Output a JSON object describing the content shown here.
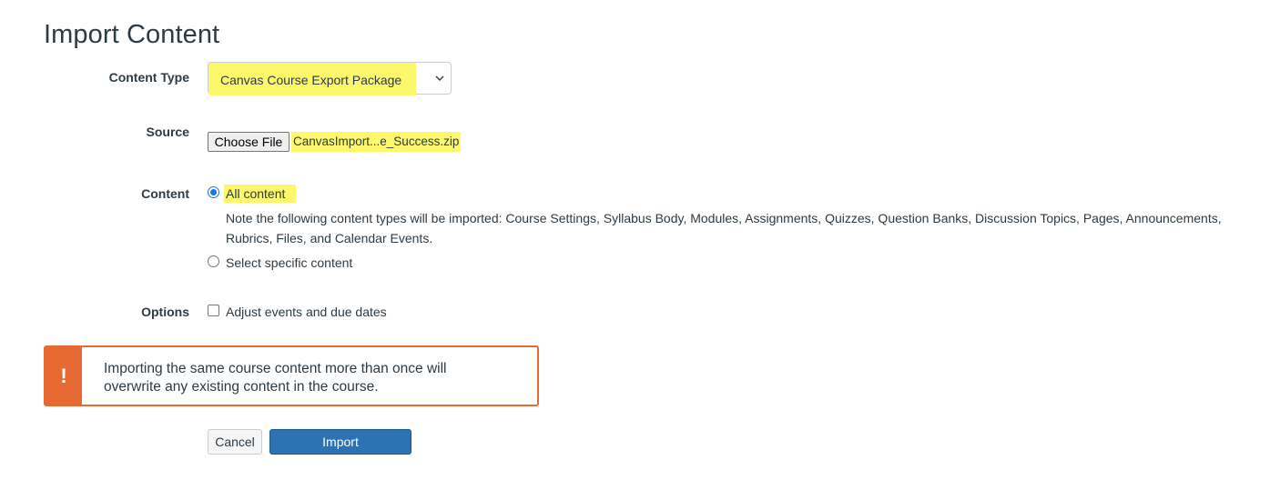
{
  "page": {
    "title": "Import Content"
  },
  "content_type": {
    "label": "Content Type",
    "selected": "Canvas Course Export Package"
  },
  "source": {
    "label": "Source",
    "choose_file_label": "Choose File",
    "file_name": "CanvasImport...e_Success.zip"
  },
  "content": {
    "label": "Content",
    "options": [
      {
        "label": "All content",
        "checked": true
      },
      {
        "label": "Select specific content",
        "checked": false
      }
    ],
    "note": "Note the following content types will be imported: Course Settings, Syllabus Body, Modules, Assignments, Quizzes, Question Banks, Discussion Topics, Pages, Announcements, Rubrics, Files, and Calendar Events."
  },
  "options": {
    "label": "Options",
    "adjust_dates_label": "Adjust events and due dates",
    "adjust_dates_checked": false
  },
  "alert": {
    "icon": "exclamation-icon",
    "text": "Importing the same course content more than once will overwrite any existing content in the course."
  },
  "actions": {
    "cancel_label": "Cancel",
    "import_label": "Import"
  },
  "colors": {
    "highlight": "#fdf76b",
    "warning": "#e66a34",
    "primary": "#2d73b4",
    "radio_selected": "#1a73e8",
    "text": "#2d3b45"
  }
}
